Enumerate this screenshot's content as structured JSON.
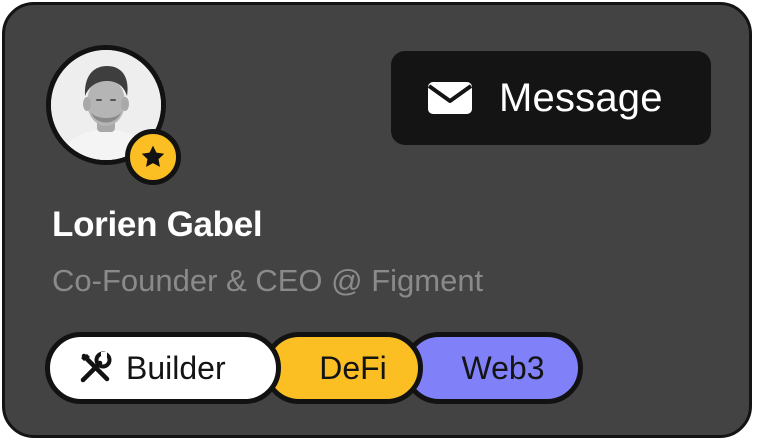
{
  "profile": {
    "name": "Lorien Gabel",
    "role": "Co-Founder & CEO @ Figment",
    "avatar_icon": "person-photo",
    "badge_icon": "star-icon"
  },
  "actions": {
    "message_label": "Message",
    "message_icon": "mail-icon"
  },
  "tags": [
    {
      "label": "Builder",
      "icon": "tools-icon",
      "color": "#ffffff"
    },
    {
      "label": "DeFi",
      "color": "#fbbf24"
    },
    {
      "label": "Web3",
      "color": "#8080f8"
    }
  ],
  "colors": {
    "card_background": "#434343",
    "button_background": "#141414",
    "accent_yellow": "#fbbf24",
    "accent_purple": "#8080f8",
    "muted_text": "#8a8a8a"
  }
}
